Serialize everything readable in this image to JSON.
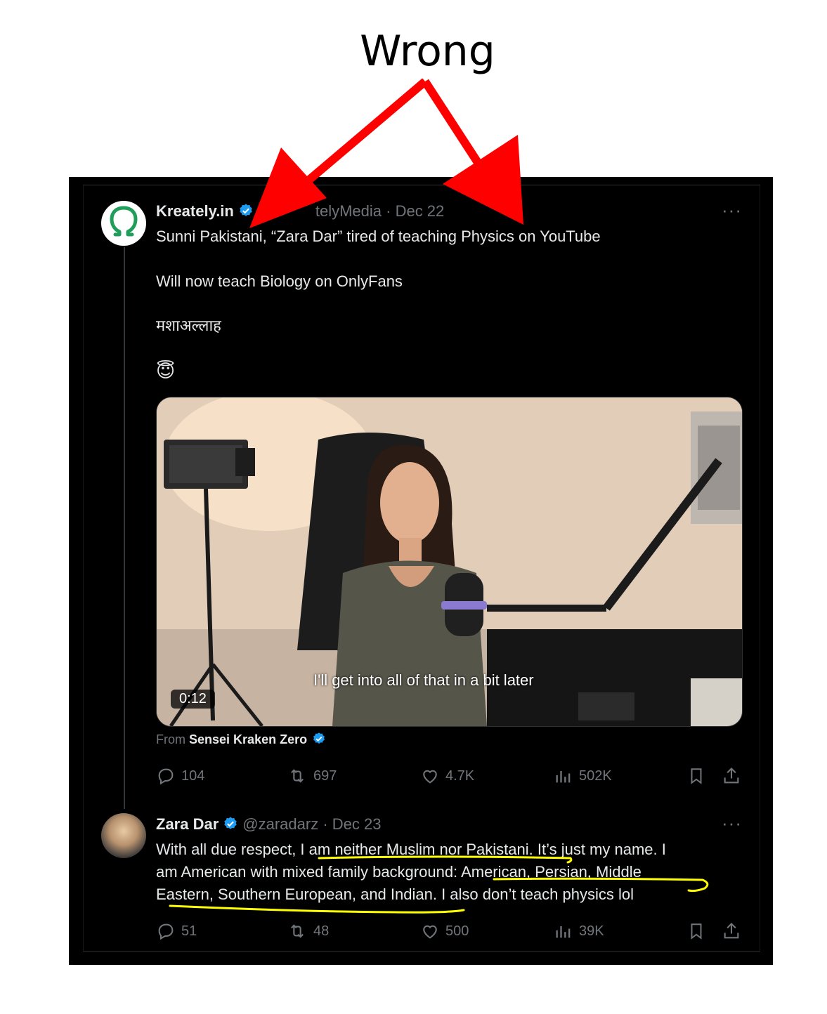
{
  "annotation": {
    "label": "Wrong",
    "arrow_color": "#ff0000",
    "highlight_color": "#ffff00"
  },
  "tweet1": {
    "display_name": "Kreately.in",
    "handle_date": "@KreatelyMedia · Dec 22",
    "handle_visible": "telyMedia · Dec 22",
    "more": "···",
    "lines": [
      "Sunni Pakistani, “Zara Dar” tired of teaching Physics on YouTube",
      "Will now teach Biology on OnlyFans",
      "मशाअल्लाह",
      "😇"
    ],
    "video": {
      "timestamp": "0:12",
      "caption": "I'll get into all of that in a bit later"
    },
    "from_prefix": "From",
    "from_name": "Sensei Kraken Zero",
    "stats": {
      "replies": "104",
      "reposts": "697",
      "likes": "4.7K",
      "views": "502K"
    }
  },
  "tweet2": {
    "display_name": "Zara Dar",
    "handle_date": "@zaradarz · Dec 23",
    "more": "···",
    "lines": [
      "With all due respect, I am neither Muslim nor Pakistani. It’s just my name. I",
      "am American with mixed family background: American, Persian, Middle",
      "Eastern, Southern European, and Indian. I also don’t teach physics lol"
    ],
    "stats": {
      "replies": "51",
      "reposts": "48",
      "likes": "500",
      "views": "39K"
    }
  }
}
